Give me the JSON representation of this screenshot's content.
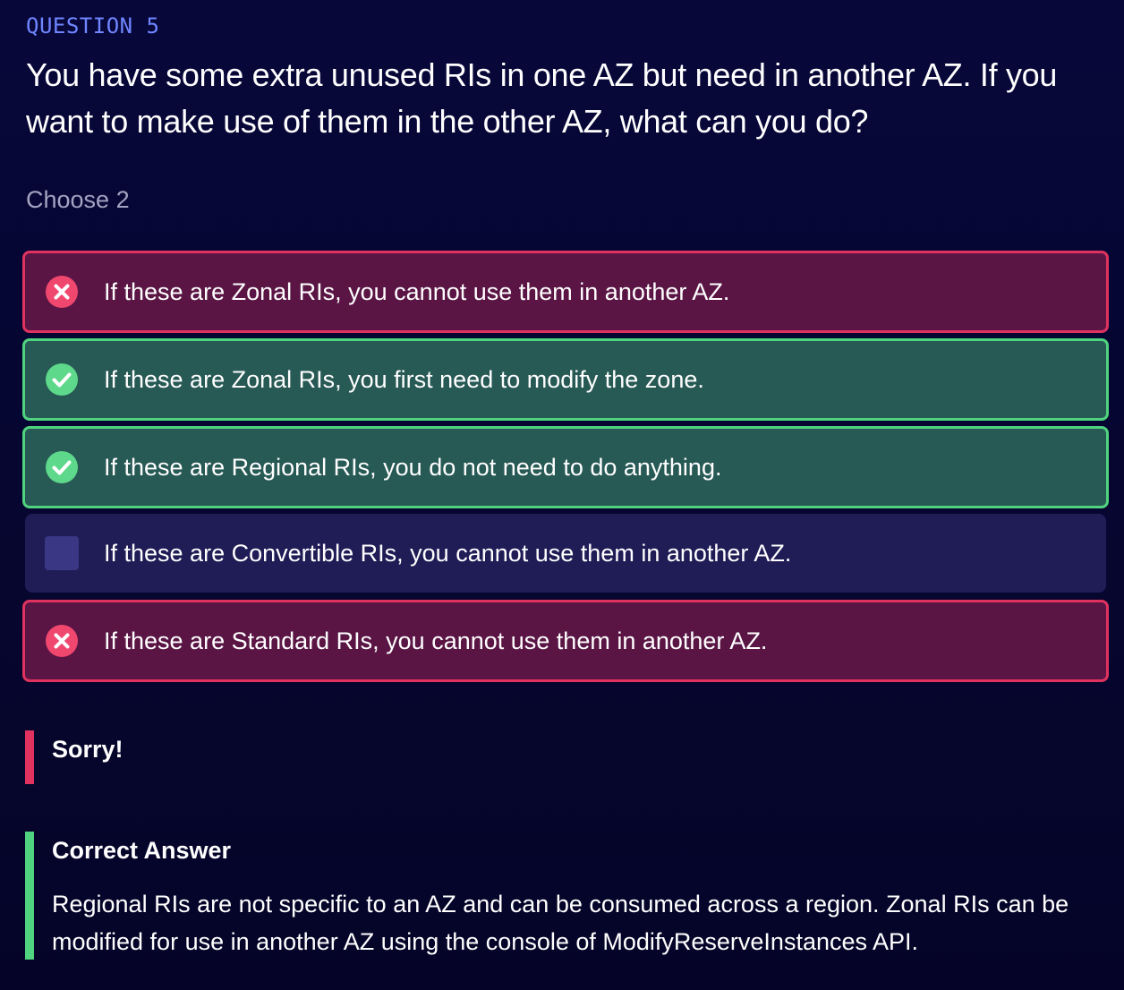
{
  "question": {
    "number_label": "QUESTION 5",
    "text": "You have some extra unused RIs in one AZ but need in another AZ. If you want to make use of them in the other AZ, what can you do?",
    "instruction": "Choose 2"
  },
  "options": [
    {
      "text": "If these are Zonal RIs, you cannot use them in another AZ.",
      "state": "wrong",
      "icon": "x-circle-icon"
    },
    {
      "text": "If these are Zonal RIs, you first need to modify the zone.",
      "state": "correct",
      "icon": "check-circle-icon"
    },
    {
      "text": "If these are Regional RIs, you do not need to do anything.",
      "state": "correct",
      "icon": "check-circle-icon"
    },
    {
      "text": "If these are Convertible RIs, you cannot use them in another AZ.",
      "state": "unselected",
      "icon": "checkbox-icon"
    },
    {
      "text": "If these are Standard RIs, you cannot use them in another AZ.",
      "state": "wrong",
      "icon": "x-circle-icon"
    }
  ],
  "feedback": {
    "result_title": "Sorry!",
    "answer_title": "Correct Answer",
    "answer_text": "Regional RIs are not specific to an AZ and can be consumed across a region. Zonal RIs can be modified for use in another AZ using the console of ModifyReserveInstances API."
  },
  "colors": {
    "background": "#07073a",
    "question_number": "#6f86ff",
    "wrong_border": "#e0325f",
    "wrong_bg": "#5a1545",
    "correct_border": "#4fd37e",
    "correct_bg": "#275955",
    "neutral_bg": "#1f1c56",
    "muted_text": "#a3a3c2"
  }
}
